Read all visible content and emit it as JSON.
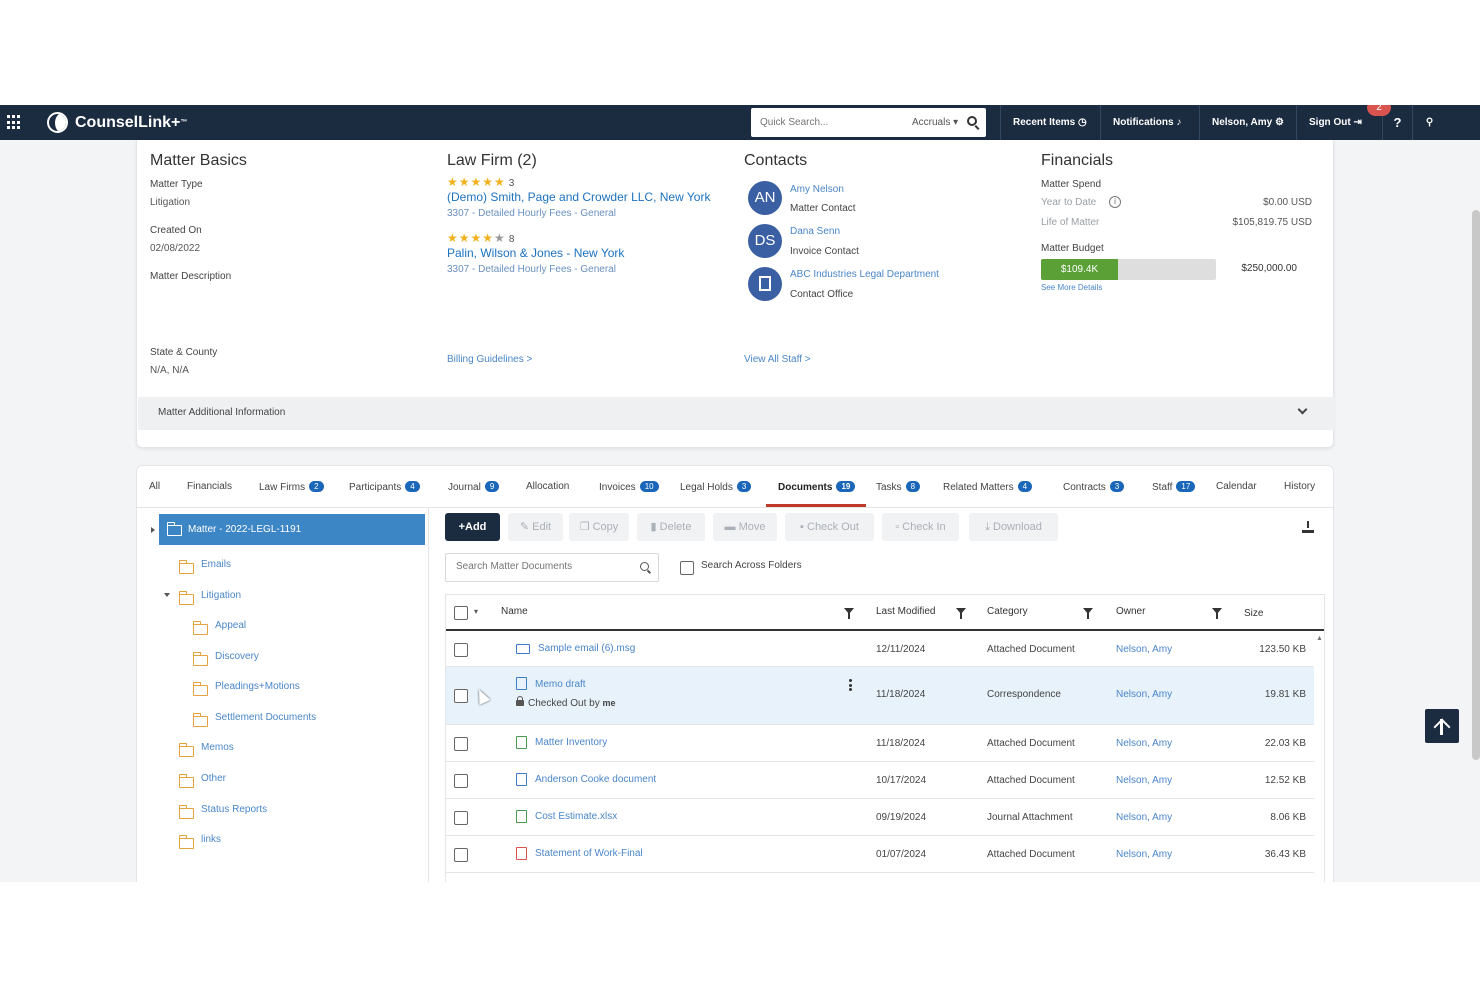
{
  "topbar": {
    "app_name": "CounselLink+",
    "trademark": "™",
    "search_placeholder": "Quick Search...",
    "search_scope": "Accruals",
    "recent_items": "Recent Items",
    "notifications": "Notifications",
    "user": "Nelson, Amy",
    "sign_out": "Sign Out",
    "help": "?",
    "notification_count": "2"
  },
  "matter_basics": {
    "title": "Matter Basics",
    "matter_type_label": "Matter Type",
    "matter_type": "Litigation",
    "created_on_label": "Created On",
    "created_on": "02/08/2022",
    "description_label": "Matter Description",
    "state_county_label": "State & County",
    "state_county": "N/A, N/A"
  },
  "law_firm": {
    "title": "Law Firm (2)",
    "firms": [
      {
        "rating": 4.5,
        "count": "3",
        "name": "(Demo) Smith, Page and Crowder LLC, New York",
        "detail": "3307 - Detailed Hourly Fees - General"
      },
      {
        "rating": 3.5,
        "count": "8",
        "name": "Palin, Wilson & Jones - New York",
        "detail": "3307 - Detailed Hourly Fees - General"
      }
    ],
    "billing_link": "Billing Guidelines >"
  },
  "contacts": {
    "title": "Contacts",
    "items": [
      {
        "initials": "AN",
        "name": "Amy Nelson",
        "role": "Matter Contact"
      },
      {
        "initials": "DS",
        "name": "Dana Senn",
        "role": "Invoice Contact"
      },
      {
        "initials": "",
        "name": "ABC Industries Legal Department",
        "role": "Contact Office"
      }
    ],
    "view_all": "View All Staff >"
  },
  "financials": {
    "title": "Financials",
    "spend_label": "Matter Spend",
    "ytd_label": "Year to Date",
    "ytd_value": "$0.00 USD",
    "life_label": "Life of Matter",
    "life_value": "$105,819.75 USD",
    "budget_label": "Matter Budget",
    "budget_bar_label": "$109.4K",
    "budget_fraction": 0.44,
    "budget_total": "$250,000.00",
    "see_more": "See More Details",
    "budget_color": "#5ba036"
  },
  "additional_info": "Matter Additional Information",
  "tabs": [
    {
      "label": "All",
      "count": ""
    },
    {
      "label": "Financials",
      "count": ""
    },
    {
      "label": "Law Firms",
      "count": "2"
    },
    {
      "label": "Participants",
      "count": "4"
    },
    {
      "label": "Journal",
      "count": "9"
    },
    {
      "label": "Allocation",
      "count": ""
    },
    {
      "label": "Invoices",
      "count": "10"
    },
    {
      "label": "Legal Holds",
      "count": "3"
    },
    {
      "label": "Documents",
      "count": "19"
    },
    {
      "label": "Tasks",
      "count": "8"
    },
    {
      "label": "Related Matters",
      "count": "4"
    },
    {
      "label": "Contracts",
      "count": "3"
    },
    {
      "label": "Staff",
      "count": "17"
    },
    {
      "label": "Calendar",
      "count": ""
    },
    {
      "label": "History",
      "count": ""
    }
  ],
  "tree": {
    "root": "Matter - 2022-LEGL-1191",
    "items": [
      {
        "label": "Emails"
      },
      {
        "label": "Litigation"
      },
      {
        "label": "Appeal"
      },
      {
        "label": "Discovery"
      },
      {
        "label": "Pleadings+Motions"
      },
      {
        "label": "Settlement Documents"
      },
      {
        "label": "Memos"
      },
      {
        "label": "Other"
      },
      {
        "label": "Status Reports"
      },
      {
        "label": "links"
      }
    ]
  },
  "toolbar": {
    "add": "Add",
    "edit": "Edit",
    "copy": "Copy",
    "delete": "Delete",
    "move": "Move",
    "check_out": "Check Out",
    "check_in": "Check In",
    "download": "Download"
  },
  "doc_search": {
    "placeholder": "Search Matter Documents",
    "across_label": "Search Across Folders"
  },
  "table": {
    "headers": {
      "name": "Name",
      "modified": "Last Modified",
      "category": "Category",
      "owner": "Owner",
      "size": "Size"
    },
    "rows": [
      {
        "icon": "mail-icon",
        "name": "Sample email (6).msg",
        "modified": "12/11/2024",
        "category": "Attached Document",
        "owner": "Nelson, Amy",
        "size": "123.50 KB"
      },
      {
        "icon": "word-doc-icon",
        "name": "Memo draft",
        "sub_prefix": "Checked Out by",
        "sub_who": "me",
        "modified": "11/18/2024",
        "category": "Correspondence",
        "owner": "Nelson, Amy",
        "size": "19.81 KB"
      },
      {
        "icon": "excel-doc-icon",
        "name": "Matter Inventory",
        "modified": "11/18/2024",
        "category": "Attached Document",
        "owner": "Nelson, Amy",
        "size": "22.03 KB"
      },
      {
        "icon": "word-doc-icon",
        "name": "Anderson Cooke document",
        "modified": "10/17/2024",
        "category": "Attached Document",
        "owner": "Nelson, Amy",
        "size": "12.52 KB"
      },
      {
        "icon": "excel-doc-icon",
        "name": "Cost Estimate.xlsx",
        "modified": "09/19/2024",
        "category": "Journal Attachment",
        "owner": "Nelson, Amy",
        "size": "8.06 KB"
      },
      {
        "icon": "pdf-doc-icon",
        "name": "Statement of Work-Final",
        "modified": "01/07/2024",
        "category": "Attached Document",
        "owner": "Nelson, Amy",
        "size": "36.43 KB"
      }
    ]
  }
}
